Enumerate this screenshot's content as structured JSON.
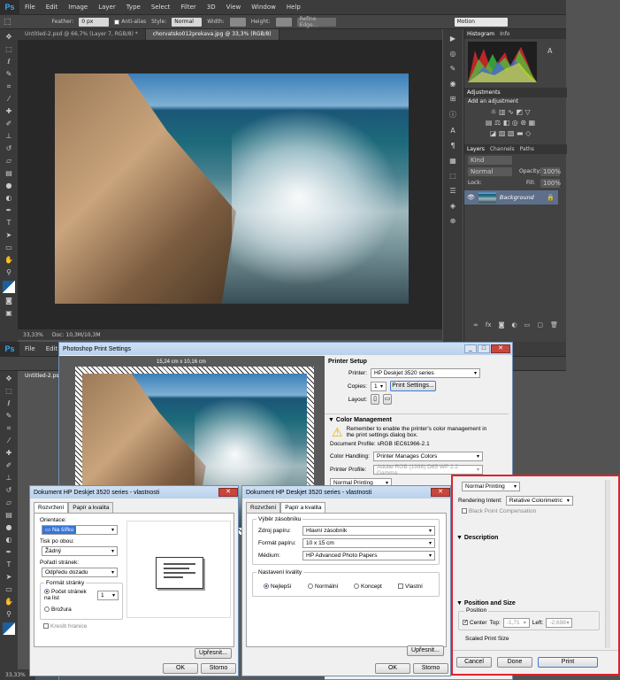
{
  "menu": {
    "logo": "Ps",
    "items": [
      "File",
      "Edit",
      "Image",
      "Layer",
      "Type",
      "Select",
      "Filter",
      "3D",
      "View",
      "Window",
      "Help"
    ]
  },
  "options": {
    "feather_label": "Feather:",
    "feather_value": "0 px",
    "antialias": "Anti-alias",
    "style_label": "Style:",
    "style_value": "Normal",
    "width_label": "Width:",
    "height_label": "Height:",
    "refine_edge": "Refine Edge...",
    "workspace": "Motion"
  },
  "tabs": {
    "tab1": "Untitled-2.psd @ 66,7% (Layer 7, RGB/8) *",
    "tab2": "chorvatsko012prekava.jpg @ 33,3% (RGB/8)"
  },
  "status": {
    "zoom": "33,33%",
    "doc": "Doc: 10,3M/10,3M"
  },
  "panels": {
    "histogram_tab": "Histogram",
    "info_tab": "Info",
    "adjustments_tab": "Adjustments",
    "add_adjustment": "Add an adjustment",
    "layers_tab": "Layers",
    "channels_tab": "Channels",
    "paths_tab": "Paths",
    "kind": "Kind",
    "blend": "Normal",
    "opacity_label": "Opacity:",
    "opacity": "100%",
    "lock_label": "Lock:",
    "fill_label": "Fill:",
    "fill": "100%",
    "layer_name": "Background"
  },
  "lower": {
    "tab1": "Untitled-2.psd",
    "zoom": "33,33%"
  },
  "print_dialog": {
    "title": "Photoshop Print Settings",
    "size": "15,24 cm x 10,16 cm",
    "printer_setup": "Printer Setup",
    "printer_label": "Printer:",
    "printer_value": "HP Deskjet 3520 series",
    "copies_label": "Copies:",
    "copies_value": "1",
    "print_settings_btn": "Print Settings...",
    "layout_label": "Layout:",
    "color_mgmt": "Color Management",
    "remember": "Remember to enable the printer's color management in the print settings dialog box.",
    "doc_profile": "Document Profile: sRGB IEC61966-2.1",
    "color_handling_label": "Color Handling:",
    "color_handling": "Printer Manages Colors",
    "printer_profile_label": "Printer Profile:",
    "printer_profile": "Adobe RGB (1998) D65 WP 2.2 Gamma",
    "normal_printing": "Normal Printing",
    "rendering_label": "Rendering Intent:",
    "rendering": "Relative Colorimetric",
    "bpc": "Black Point Compensation",
    "description": "Description",
    "position_size": "Position and Size",
    "position": "Position",
    "center": "Center",
    "top_label": "Top:",
    "top": "-1,71",
    "left_label": "Left:",
    "left": "-2,698",
    "scaled": "Scaled Print Size",
    "cancel": "Cancel",
    "done": "Done",
    "print": "Print"
  },
  "dlg1": {
    "title": "Dokument HP Deskjet 3520 series - vlastnosti",
    "tab1": "Rozvržení",
    "tab2": "Papír a kvalita",
    "orientation_label": "Orientace:",
    "orientation": "Na šířku",
    "duplex_label": "Tisk po obou:",
    "duplex": "Žádný",
    "order_label": "Pořadí stránek:",
    "order": "Odpředu dozadu",
    "format_label": "Formát stránky",
    "pages_per_sheet": "Počet stránek na list",
    "pages_value": "1",
    "booklet": "Brožura",
    "borders": "Kreslit hranice",
    "advanced": "Upřesnit...",
    "ok": "OK",
    "cancel": "Storno"
  },
  "dlg2": {
    "title": "Dokument HP Deskjet 3520 series - vlastnosti",
    "tab1": "Rozvržení",
    "tab2": "Papír a kvalita",
    "tray_group": "Výběr zásobníku",
    "source_label": "Zdroj papíru:",
    "source": "Hlavní zásobník",
    "size_label": "Formát papíru:",
    "size": "10 x 15 cm",
    "media_label": "Médium:",
    "media": "HP Advanced Photo Papers",
    "quality_group": "Nastavení kvality",
    "q1": "Nejlepší",
    "q2": "Normální",
    "q3": "Koncept",
    "q4": "Vlastní",
    "advanced": "Upřesnit...",
    "ok": "OK",
    "cancel": "Storno"
  }
}
